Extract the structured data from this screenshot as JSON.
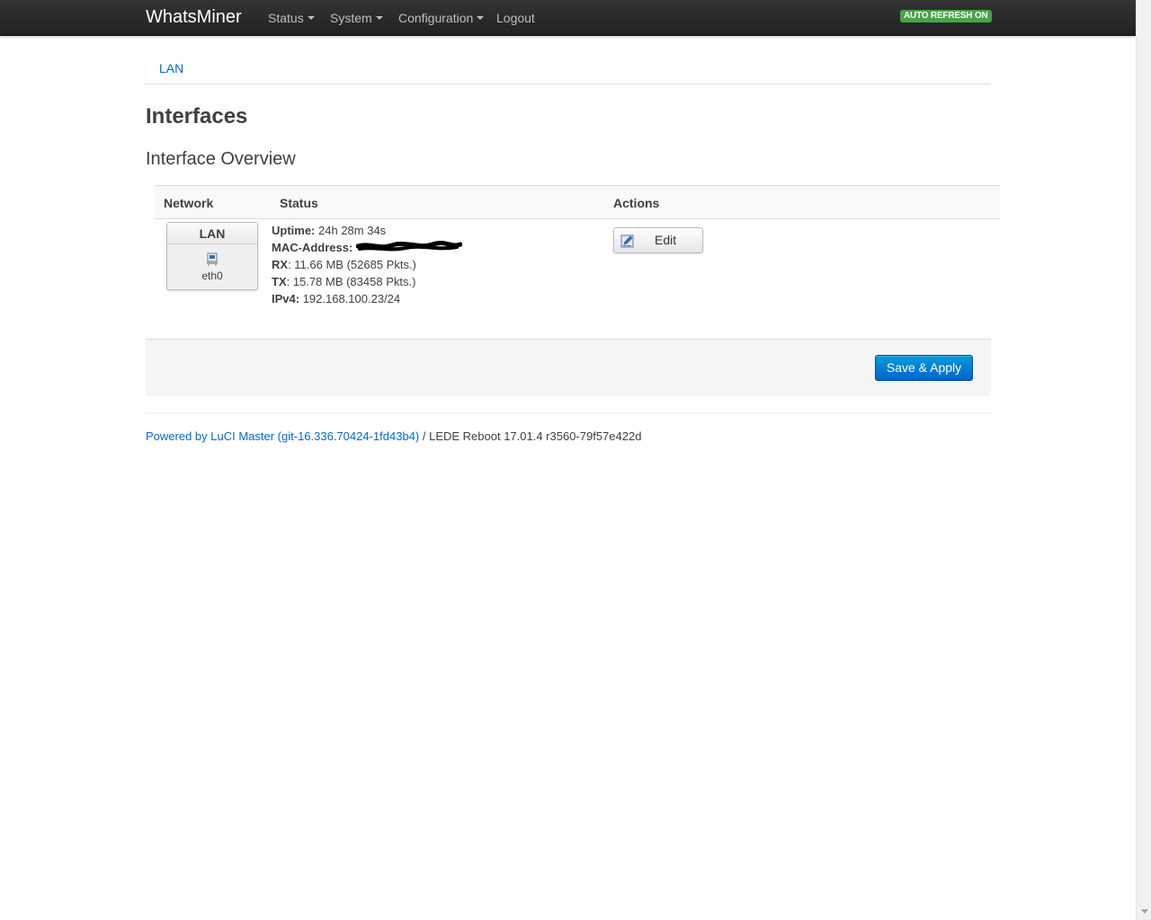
{
  "navbar": {
    "brand": "WhatsMiner",
    "menu": [
      {
        "label": "Status",
        "has_dropdown": true
      },
      {
        "label": "System",
        "has_dropdown": true
      },
      {
        "label": "Configuration",
        "has_dropdown": true
      },
      {
        "label": "Logout",
        "has_dropdown": false
      }
    ],
    "auto_refresh": "AUTO REFRESH ON"
  },
  "tabs": [
    {
      "label": "LAN"
    }
  ],
  "page": {
    "title": "Interfaces",
    "subtitle": "Interface Overview"
  },
  "table": {
    "headers": [
      "Network",
      "Status",
      "Actions"
    ],
    "rows": [
      {
        "network_name": "LAN",
        "device": "eth0",
        "status": {
          "uptime_label": "Uptime:",
          "uptime_value": "24h 28m 34s",
          "mac_label": "MAC-Address:",
          "mac_value": "",
          "rx_label": "RX",
          "rx_value": ": 11.66 MB (52685 Pkts.)",
          "tx_label": "TX",
          "tx_value": ": 15.78 MB (83458 Pkts.)",
          "ipv4_label": "IPv4:",
          "ipv4_value": "192.168.100.23/24"
        },
        "edit_label": "Edit"
      }
    ]
  },
  "actions": {
    "save_apply_label": "Save & Apply"
  },
  "footer": {
    "link_text": "Powered by LuCI Master (git-16.336.70424-1fd43b4)",
    "rest_text": " / LEDE Reboot 17.01.4 r3560-79f57e422d"
  },
  "colors": {
    "navbar_bg": "#222222",
    "link": "#0069d6",
    "primary_button": "#0064cd",
    "badge_success": "#46a546"
  },
  "icons": {
    "network": "ethernet-port-icon",
    "edit": "edit-pencil-icon"
  }
}
